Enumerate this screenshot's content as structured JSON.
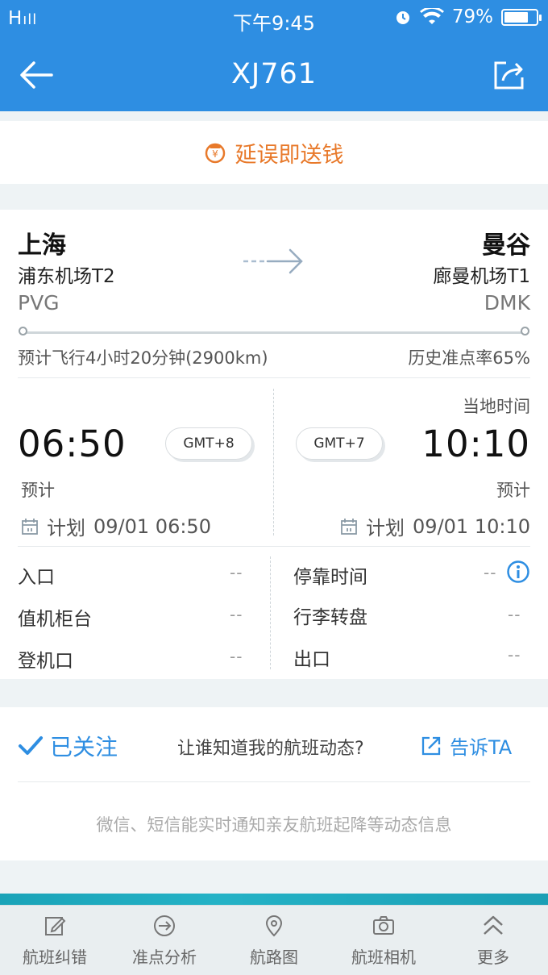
{
  "status_bar": {
    "signal": "H",
    "time": "下午9:45",
    "battery": "79%",
    "battery_level": 0.79,
    "icons": [
      "signal-icon",
      "alarm-icon",
      "wifi-icon",
      "battery-icon"
    ]
  },
  "header": {
    "title": "XJ761",
    "back_icon": "back-arrow-icon",
    "share_icon": "share-icon"
  },
  "promo": {
    "text": "延误即送钱",
    "icon": "coin-icon",
    "color": "#e8792a"
  },
  "flight": {
    "departure": {
      "city": "上海",
      "airport": "浦东机场T2",
      "code": "PVG",
      "time": "06:50",
      "timezone": "GMT+8",
      "status": "预计",
      "plan_label": "计划",
      "plan_time": "09/01 06:50"
    },
    "arrival": {
      "city": "曼谷",
      "airport": "廊曼机场T1",
      "code": "DMK",
      "time": "10:10",
      "timezone": "GMT+7",
      "status": "预计",
      "plan_label": "计划",
      "plan_time": "09/01 10:10"
    },
    "duration": "预计飞行4小时20分钟(2900km)",
    "on_time_rate": "历史准点率65%",
    "local_time_label": "当地时间"
  },
  "details": {
    "left": [
      {
        "label": "入口",
        "value": "--"
      },
      {
        "label": "值机柜台",
        "value": "--"
      },
      {
        "label": "登机口",
        "value": "--"
      }
    ],
    "right": [
      {
        "label": "停靠时间",
        "value": "--"
      },
      {
        "label": "行李转盘",
        "value": "--"
      },
      {
        "label": "出口",
        "value": "--"
      }
    ]
  },
  "follow": {
    "followed_label": "已关注",
    "question": "让谁知道我的航班动态?",
    "tell_label": "告诉TA",
    "notice": "微信、短信能实时通知亲友航班起降等动态信息"
  },
  "tabbar": {
    "items": [
      {
        "label": "航班纠错",
        "icon": "edit-icon"
      },
      {
        "label": "准点分析",
        "icon": "clock-plane-icon"
      },
      {
        "label": "航路图",
        "icon": "map-pin-icon"
      },
      {
        "label": "航班相机",
        "icon": "camera-icon"
      },
      {
        "label": "更多",
        "icon": "chevron-up-icon"
      }
    ]
  },
  "colors": {
    "primary": "#2e8ee2",
    "accent": "#e8792a",
    "background": "#eef3f5"
  }
}
